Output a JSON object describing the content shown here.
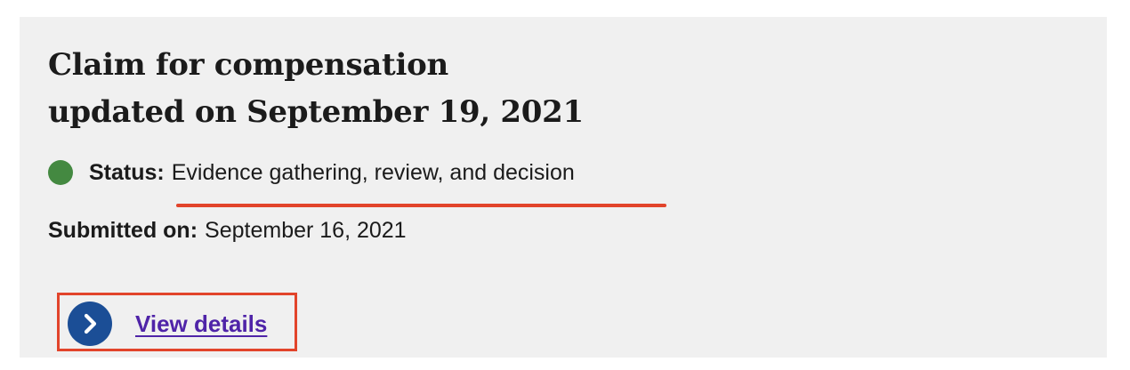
{
  "card": {
    "title_line1": "Claim for compensation",
    "title_line2": "updated on September 19, 2021",
    "status": {
      "label": "Status:",
      "value": "Evidence gathering, review, and decision",
      "indicator_icon": "status-dot-icon"
    },
    "submitted": {
      "label": "Submitted on:",
      "value": "September 16, 2021"
    },
    "action": {
      "label": "View details",
      "icon": "chevron-right-circle-icon"
    }
  },
  "colors": {
    "card_background": "#f0f0f0",
    "status_dot": "#448941",
    "annotation_red": "#e2442b",
    "link": "#4f24a8",
    "icon_circle": "#1b4e96"
  }
}
